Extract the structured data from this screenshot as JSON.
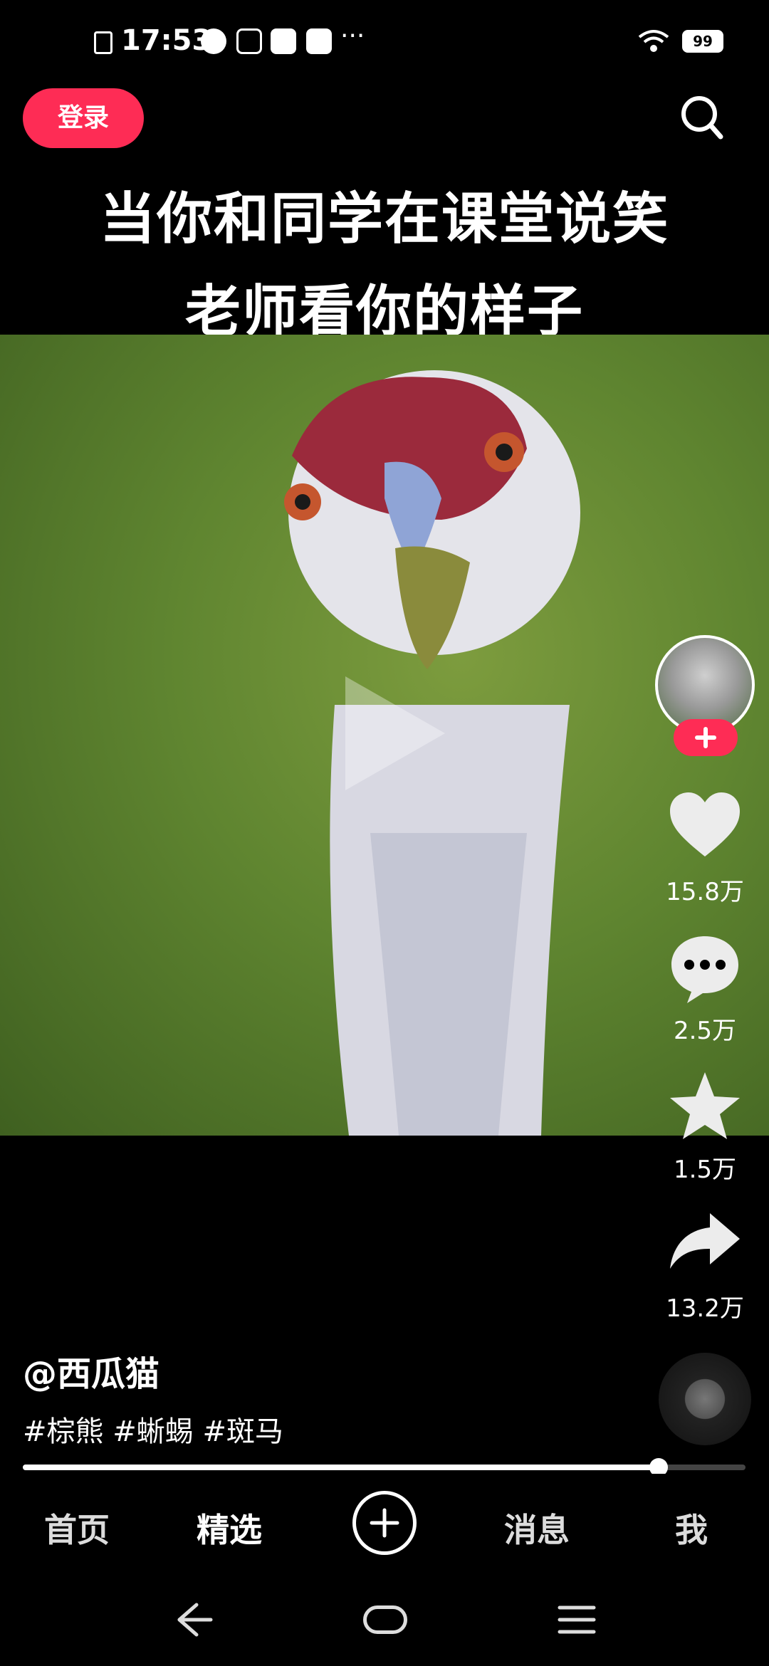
{
  "status_bar": {
    "time": "17:53",
    "battery": "99"
  },
  "header": {
    "login_label": "登录"
  },
  "video": {
    "caption_line1": "当你和同学在课堂说笑",
    "caption_line2": "老师看你的样子"
  },
  "actions": {
    "likes": "15.8万",
    "comments": "2.5万",
    "favorites": "1.5万",
    "shares": "13.2万"
  },
  "post": {
    "author": "@西瓜猫",
    "hashtags": "#棕熊 #蜥蜴 #斑马"
  },
  "playback": {
    "progress": 0.88
  },
  "tabs": {
    "home": "首页",
    "featured": "精选",
    "messages": "消息",
    "me": "我"
  },
  "colors": {
    "accent": "#fe2c55",
    "background": "#000000"
  }
}
